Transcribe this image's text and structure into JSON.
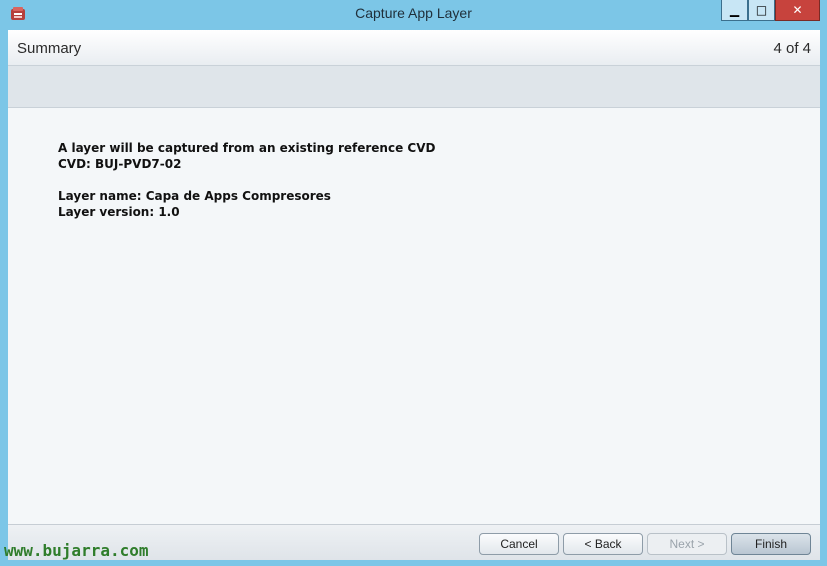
{
  "window": {
    "title": "Capture App Layer",
    "min_glyph": "▁",
    "max_glyph": "□",
    "close_glyph": "✕"
  },
  "header": {
    "title": "Summary",
    "step": "4 of 4"
  },
  "summary": {
    "line1": "A layer will be captured from an existing reference CVD",
    "line2": "CVD: BUJ-PVD7-02",
    "line3": "Layer name: Capa de Apps Compresores",
    "line4": "Layer version: 1.0"
  },
  "footer": {
    "cancel": "Cancel",
    "back": "< Back",
    "next": "Next >",
    "finish": "Finish"
  },
  "watermark": "www.bujarra.com",
  "colors": {
    "title_bar": "#7cc6e7",
    "close": "#c7433d",
    "watermark": "#2f7d2b"
  }
}
